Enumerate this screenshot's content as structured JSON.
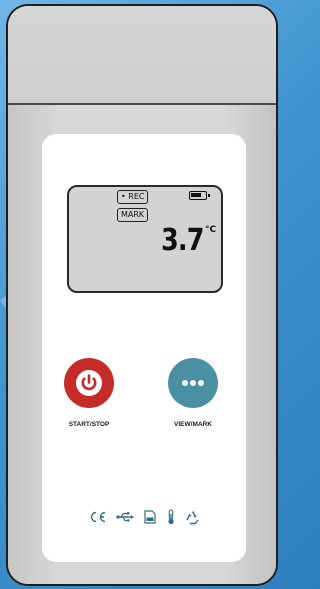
{
  "device": {
    "display": {
      "rec_label": "• REC",
      "mark_label": "MARK",
      "temperature": "3.7",
      "unit": "°C",
      "battery_level": 0.75
    },
    "buttons": {
      "start_stop_label": "START/STOP",
      "view_mark_label": "VIEW/MARK"
    },
    "certification_icons": [
      "ce-mark-icon",
      "usb-icon",
      "pdf-file-icon",
      "thermometer-icon",
      "recycle-icon"
    ],
    "colors": {
      "start_button": "#c52b27",
      "view_button": "#4b8fa3",
      "icon_color": "#2f6f85"
    }
  }
}
